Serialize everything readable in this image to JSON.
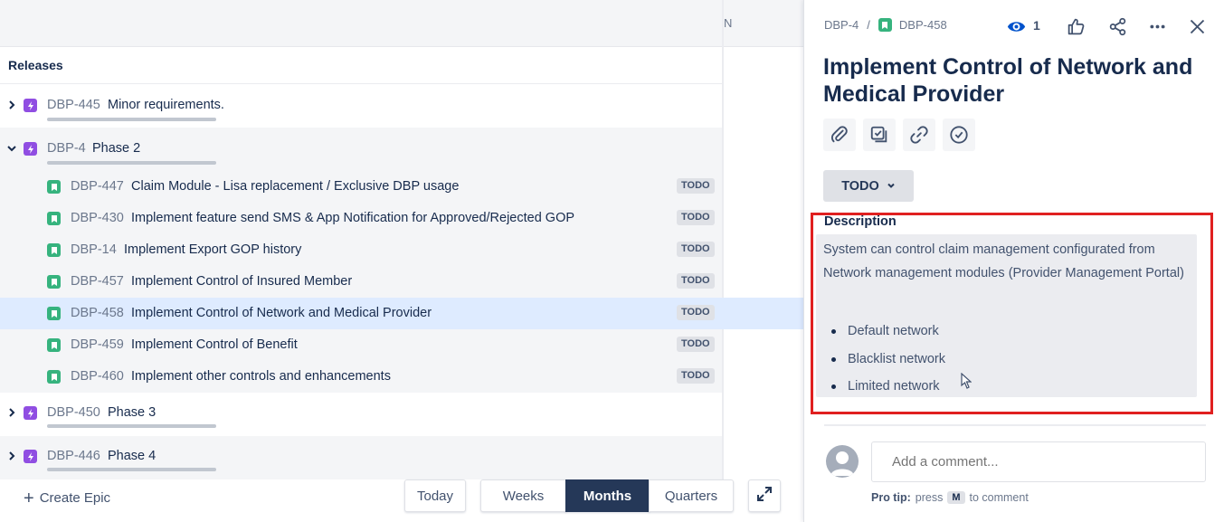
{
  "roadmap": {
    "timeline_header_fragment": "N",
    "releases_label": "Releases",
    "epics": [
      {
        "key": "DBP-445",
        "summary": "Minor requirements.",
        "expanded": false
      },
      {
        "key": "DBP-4",
        "summary": "Phase 2",
        "expanded": true,
        "children": [
          {
            "key": "DBP-447",
            "summary": "Claim Module - Lisa replacement / Exclusive DBP usage",
            "status": "TODO"
          },
          {
            "key": "DBP-430",
            "summary": "Implement feature send SMS & App Notification for Approved/Rejected GOP",
            "status": "TODO"
          },
          {
            "key": "DBP-14",
            "summary": "Implement Export GOP history",
            "status": "TODO"
          },
          {
            "key": "DBP-457",
            "summary": "Implement Control of Insured Member",
            "status": "TODO"
          },
          {
            "key": "DBP-458",
            "summary": "Implement Control of Network and Medical Provider",
            "status": "TODO",
            "selected": true
          },
          {
            "key": "DBP-459",
            "summary": "Implement Control of Benefit",
            "status": "TODO"
          },
          {
            "key": "DBP-460",
            "summary": "Implement other controls and enhancements",
            "status": "TODO"
          }
        ]
      },
      {
        "key": "DBP-450",
        "summary": "Phase 3",
        "expanded": false
      },
      {
        "key": "DBP-446",
        "summary": "Phase 4",
        "expanded": false
      }
    ],
    "toolbar": {
      "create_epic": "Create Epic",
      "today": "Today",
      "weeks": "Weeks",
      "months": "Months",
      "quarters": "Quarters",
      "active_scale": "Months"
    }
  },
  "detail": {
    "breadcrumb": {
      "parent": "DBP-4",
      "separator": "/",
      "issue": "DBP-458"
    },
    "watchers": "1",
    "title": "Implement Control of Network and Medical Provider",
    "quick_actions": [
      "attach-icon",
      "subtask-icon",
      "link-icon",
      "clock-icon"
    ],
    "status": "TODO",
    "description": {
      "label": "Description",
      "text": "System can control claim management configurated from Network management modules (Provider Management Portal)",
      "bullets": [
        "Default network",
        "Blacklist network",
        "Limited network"
      ]
    },
    "comment": {
      "placeholder": "Add a comment...",
      "protip_prefix": "Pro tip:",
      "protip_press": "press",
      "protip_key": "M",
      "protip_suffix": "to comment"
    }
  },
  "colors": {
    "epic": "#904ee2",
    "story": "#36b37e",
    "selected_row": "#deebff",
    "active_scale": "#253858",
    "highlight_box": "#e02020",
    "watch_icon": "#0052cc"
  }
}
